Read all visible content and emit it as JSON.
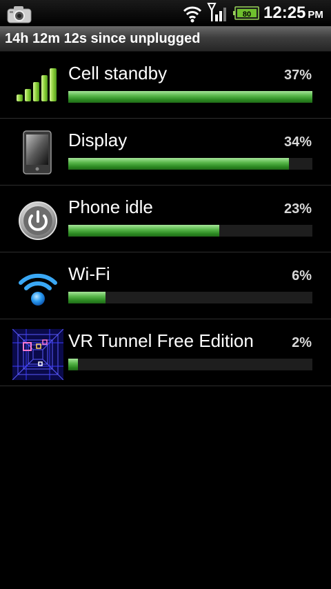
{
  "status_bar": {
    "time": "12:25",
    "ampm": "PM",
    "icons": [
      "camera-icon",
      "wifi-icon",
      "signal-icon",
      "battery-icon"
    ],
    "battery_level": "80"
  },
  "header": {
    "text": "14h 12m 12s since unplugged"
  },
  "items": [
    {
      "name": "Cell standby",
      "percent_label": "37%",
      "bar_fraction": 1.0,
      "icon": "cell-signal-icon"
    },
    {
      "name": "Display",
      "percent_label": "34%",
      "bar_fraction": 0.905,
      "icon": "display-icon"
    },
    {
      "name": "Phone idle",
      "percent_label": "23%",
      "bar_fraction": 0.62,
      "icon": "power-icon"
    },
    {
      "name": "Wi-Fi",
      "percent_label": "6%",
      "bar_fraction": 0.152,
      "icon": "wifi-icon"
    },
    {
      "name": "VR Tunnel Free Edition",
      "percent_label": "2%",
      "bar_fraction": 0.04,
      "icon": "vr-tunnel-app-icon"
    }
  ],
  "colors": {
    "bar_green": "#3fa033",
    "bar_track": "#1e1e1e",
    "background": "#000000"
  }
}
